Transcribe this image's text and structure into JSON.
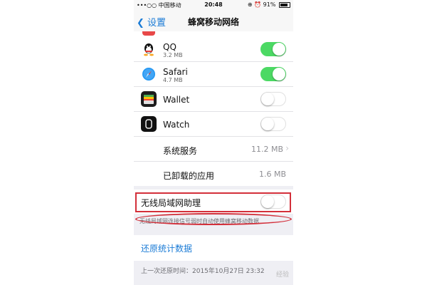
{
  "status_bar": {
    "carrier": "•••○○ 中国移动",
    "wifi_icon": "wifi-icon",
    "time": "20:48",
    "battery_text": "91%",
    "icons_right": "⊕ ⏰"
  },
  "nav": {
    "back_label": "设置",
    "title": "蜂窝移动网络"
  },
  "apps": [
    {
      "name": "QQ",
      "size": "3.2 MB",
      "icon": "qq-icon",
      "enabled": true,
      "color": "#111111"
    },
    {
      "name": "Safari",
      "size": "4.7 MB",
      "icon": "safari-icon",
      "enabled": true,
      "color": "#1e88e5"
    },
    {
      "name": "Wallet",
      "size": "",
      "icon": "wallet-icon",
      "enabled": false,
      "color": "#222222"
    },
    {
      "name": "Watch",
      "size": "",
      "icon": "watch-icon",
      "enabled": false,
      "color": "#111111"
    }
  ],
  "system_rows": [
    {
      "label": "系统服务",
      "value": "11.2 MB",
      "has_chevron": true
    },
    {
      "label": "已卸载的应用",
      "value": "1.6 MB",
      "has_chevron": false
    }
  ],
  "wlan_assist": {
    "label": "无线局域网助理",
    "enabled": false,
    "footer": "无线局域网连接信号弱时自动使用蜂窝移动数据"
  },
  "reset": {
    "label": "还原统计数据",
    "last_reset": "上一次还原时间：2015年10月27日 23:32"
  },
  "watermark": "经验",
  "colors": {
    "accent": "#1a7bd6",
    "switch_on": "#4cd964",
    "annotation_red": "#d32f3a"
  }
}
